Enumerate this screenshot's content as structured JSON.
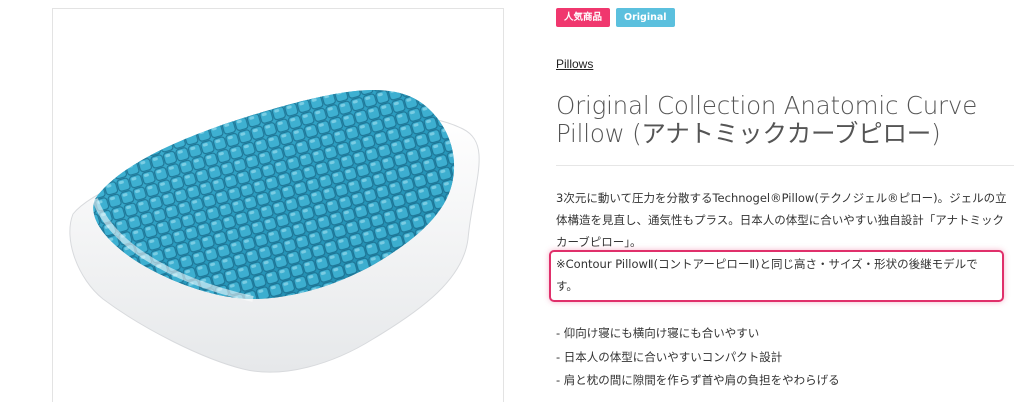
{
  "badges": {
    "popular": "人気商品",
    "original": "Original"
  },
  "category_link": "Pillows",
  "product": {
    "title_line1": "Original Collection Anatomic Curve",
    "title_line2": "Pillow (アナトミックカーブピロー)"
  },
  "description": {
    "line1": "3次元に動いて圧力を分散するTechnogel®Pillow(テクノジェル®ピロー)。ジェルの立",
    "line2": "体構造を見直し、通気性もプラス。日本人の体型に合いやすい独自設計「アナトミック",
    "line3": "カーブピロー」。",
    "note_line1": "※Contour PillowⅡ(コントアーピローⅡ)と同じ高さ・サイズ・形状の後継モデルで",
    "note_line2": "す。"
  },
  "features": [
    "- 仰向け寝にも横向け寝にも合いやすい",
    "- 日本人の体型に合いやすいコンパクト設計",
    "- 肩と枕の間に隙間を作らず首や肩の負担をやわらげる"
  ],
  "colors": {
    "badge_pink": "#f0376e",
    "badge_blue": "#5bc0de",
    "highlight": "#e0306b",
    "gel": "#2f9fbf"
  }
}
